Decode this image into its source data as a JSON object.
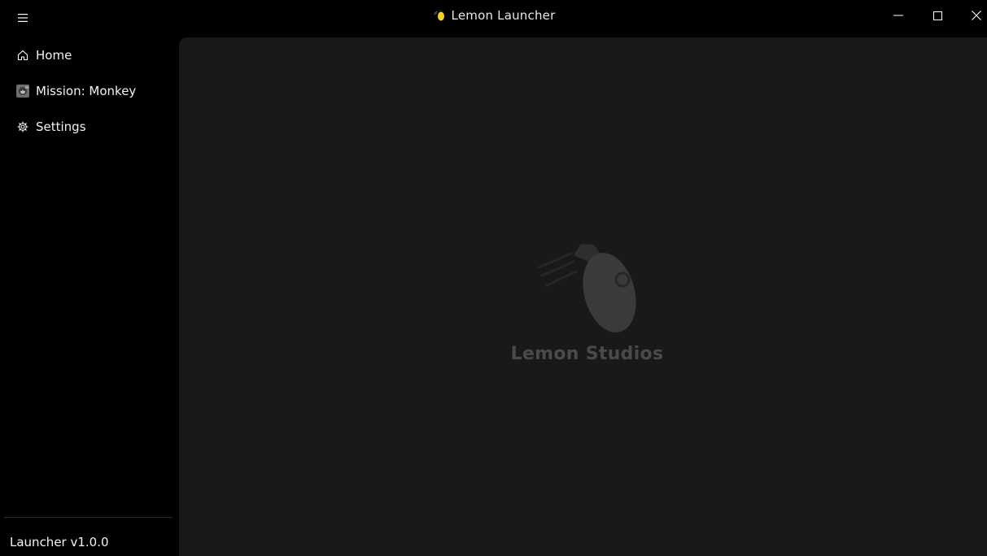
{
  "window": {
    "title": "Lemon Launcher",
    "controls": [
      "minimize",
      "maximize",
      "close"
    ]
  },
  "sidebar": {
    "items": [
      {
        "label": "Home",
        "icon": "home-icon"
      },
      {
        "label": "Mission: Monkey",
        "icon": "game-thumbnail-icon"
      },
      {
        "label": "Settings",
        "icon": "gear-icon"
      }
    ],
    "footer_version": "Launcher v1.0.0"
  },
  "main": {
    "studio_name": "Lemon Studios",
    "logo_icon": "lemon-logo-icon"
  },
  "colors": {
    "background": "#000000",
    "content_background": "#191919",
    "logo": "#3a3a3a",
    "studio_text": "#4a4a4a",
    "lemon_accent": "#f4d21f"
  }
}
